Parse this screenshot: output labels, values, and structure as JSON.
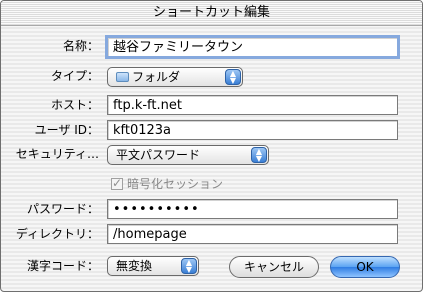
{
  "window": {
    "title": "ショートカット編集"
  },
  "form": {
    "name": {
      "label": "名称：",
      "value": "越谷ファミリータウン"
    },
    "type": {
      "label": "タイプ：",
      "value": "フォルダ",
      "icon": "folder-icon"
    },
    "host": {
      "label": "ホスト：",
      "value": "ftp.k-ft.net"
    },
    "user": {
      "label": "ユーザ ID：",
      "value": "kft0123a"
    },
    "security": {
      "label": "セキュリティ…",
      "value": "平文パスワード"
    },
    "secure_session": {
      "label": "暗号化セッション",
      "checked": true,
      "enabled": false
    },
    "password": {
      "label": "パスワード：",
      "value": "••••••••••"
    },
    "directory": {
      "label": "ディレクトリ：",
      "value": "/homepage"
    },
    "charset": {
      "label": "漢字コード：",
      "value": "無変換"
    }
  },
  "buttons": {
    "cancel": "キャンセル",
    "ok": "OK"
  },
  "colors": {
    "default_button": "#2f7de3",
    "focus_ring": "#86a9de"
  }
}
